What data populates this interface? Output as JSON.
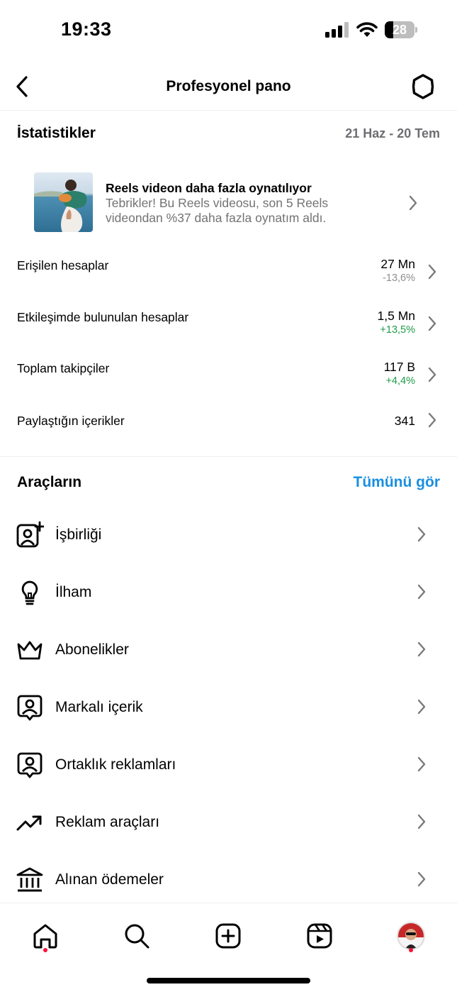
{
  "status_bar": {
    "time": "19:33",
    "battery_level": "28",
    "battery_fraction": 0.28,
    "icons": [
      "cellular-signal-icon",
      "wifi-icon",
      "battery-icon"
    ]
  },
  "header": {
    "title": "Profesyonel pano",
    "back_icon": "chevron-left-icon",
    "settings_icon": "settings-gear-icon"
  },
  "statistics": {
    "title": "İstatistikler",
    "date_range": "21 Haz - 20 Tem",
    "highlight": {
      "title": "Reels videon daha fazla oynatılıyor",
      "description": "Tebrikler! Bu Reels videosu, son 5 Reels videondan %37 daha fazla oynatım aldı."
    },
    "rows": [
      {
        "label": "Erişilen hesaplar",
        "value": "27 Mn",
        "change": "-13,6%"
      },
      {
        "label": "Etkileşimde bulunulan hesaplar",
        "value": "1,5 Mn",
        "change": "+13,5%"
      },
      {
        "label": "Toplam takipçiler",
        "value": "117 B",
        "change": "+4,4%"
      },
      {
        "label": "Paylaştığın içerikler",
        "value": "341"
      }
    ]
  },
  "tools": {
    "title": "Araçların",
    "see_all": "Tümünü gör",
    "items": [
      {
        "label": "İşbirliği",
        "icon": "add-collaborator-icon"
      },
      {
        "label": "İlham",
        "icon": "lightbulb-icon"
      },
      {
        "label": "Abonelikler",
        "icon": "crown-icon"
      },
      {
        "label": "Markalı içerik",
        "icon": "branded-content-icon"
      },
      {
        "label": "Ortaklık reklamları",
        "icon": "partnership-ads-icon"
      },
      {
        "label": "Reklam araçları",
        "icon": "trending-up-icon"
      },
      {
        "label": "Alınan ödemeler",
        "icon": "bank-icon"
      }
    ]
  },
  "tab_bar": {
    "tabs": [
      "home-icon",
      "search-icon",
      "create-icon",
      "reels-icon",
      "profile-avatar"
    ],
    "accent_color": "#ff0f3a"
  },
  "colors": {
    "link": "#1a8fe0",
    "positive": "#1f9b48",
    "muted": "#737373"
  }
}
